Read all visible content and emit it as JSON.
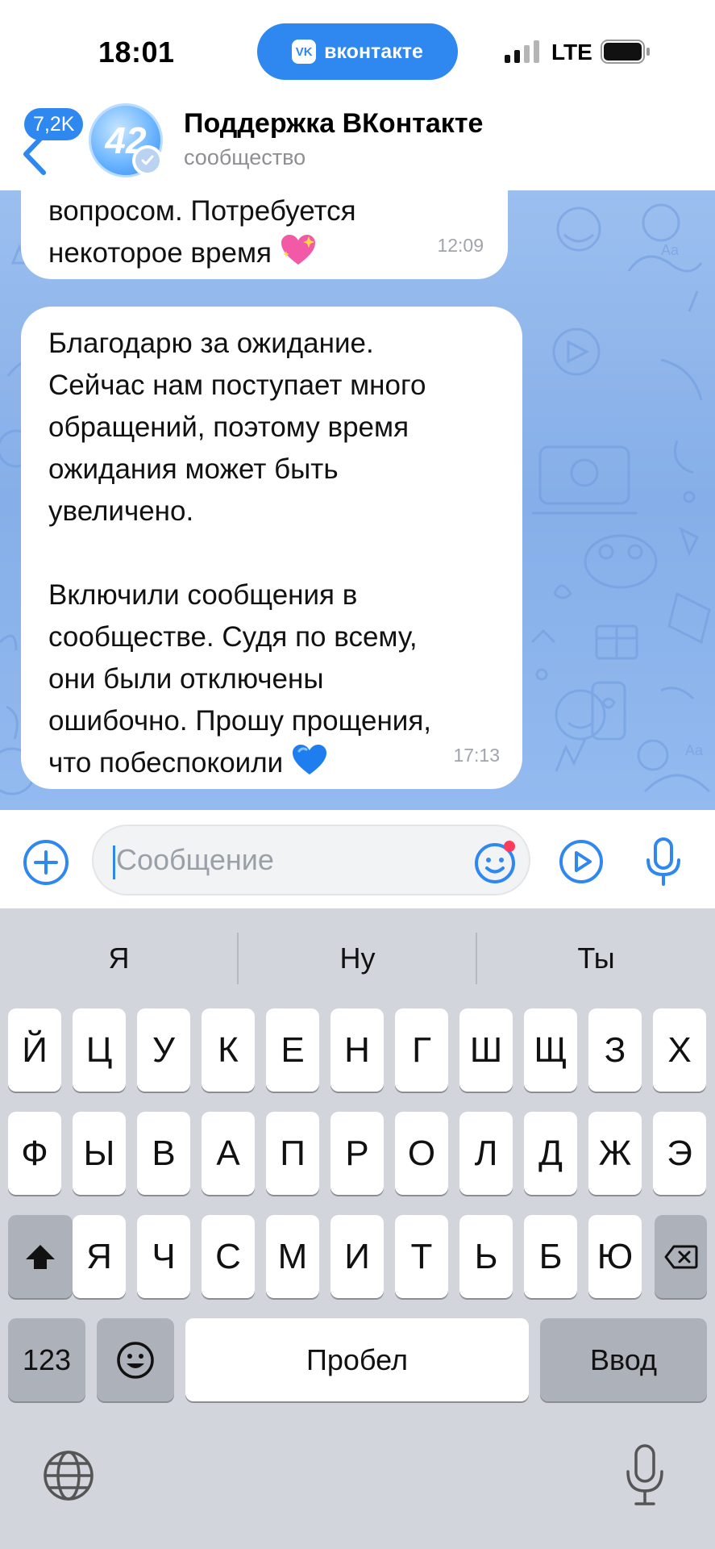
{
  "status_bar": {
    "time": "18:01",
    "app_pill": "вконтакте",
    "vk_logo": "VK",
    "network": "LTE",
    "icons": [
      "signal-icon",
      "battery-icon"
    ]
  },
  "header": {
    "unread_count": "7,2K",
    "title": "Поддержка ВКонтакте",
    "subtitle": "сообщество",
    "avatar_glyph": "42",
    "icons": [
      "back-chevron-icon",
      "verified-check-icon"
    ]
  },
  "messages": [
    {
      "lines": [
        "вопросом. Потребуется",
        "некоторое время"
      ],
      "emoji": "sparkling-heart-emoji",
      "time": "12:09"
    },
    {
      "paragraph1": [
        "Благодарю за ожидание.",
        "Сейчас нам поступает много",
        "обращений, поэтому время",
        "ожидания может быть",
        "увеличено."
      ],
      "paragraph2": [
        "Включили сообщения в",
        "сообществе. Судя по всему,",
        "они были отключены",
        "ошибочно. Прошу прощения,",
        "что побеспокоили"
      ],
      "emoji": "blue-heart-emoji",
      "time": "17:13"
    }
  ],
  "composer": {
    "placeholder": "Сообщение",
    "value": "",
    "icons": [
      "add-attachment-icon",
      "sticker-smile-icon",
      "play-circle-icon",
      "microphone-icon"
    ]
  },
  "keyboard": {
    "suggestions": [
      "Я",
      "Ну",
      "Ты"
    ],
    "row1": [
      "Й",
      "Ц",
      "У",
      "К",
      "Е",
      "Н",
      "Г",
      "Ш",
      "Щ",
      "З",
      "Х"
    ],
    "row2": [
      "Ф",
      "Ы",
      "В",
      "А",
      "П",
      "Р",
      "О",
      "Л",
      "Д",
      "Ж",
      "Э"
    ],
    "row3": [
      "Я",
      "Ч",
      "С",
      "М",
      "И",
      "Т",
      "Ь",
      "Б",
      "Ю"
    ],
    "numbers_key": "123",
    "space_key": "Пробел",
    "return_key": "Ввод",
    "icons": [
      "shift-icon",
      "backspace-icon",
      "emoji-keyboard-icon",
      "globe-icon",
      "dictation-mic-icon"
    ]
  },
  "colors": {
    "accent": "#2f87f0",
    "chat_background": "#8fb6ec",
    "keyboard_background": "#d2d5db"
  }
}
